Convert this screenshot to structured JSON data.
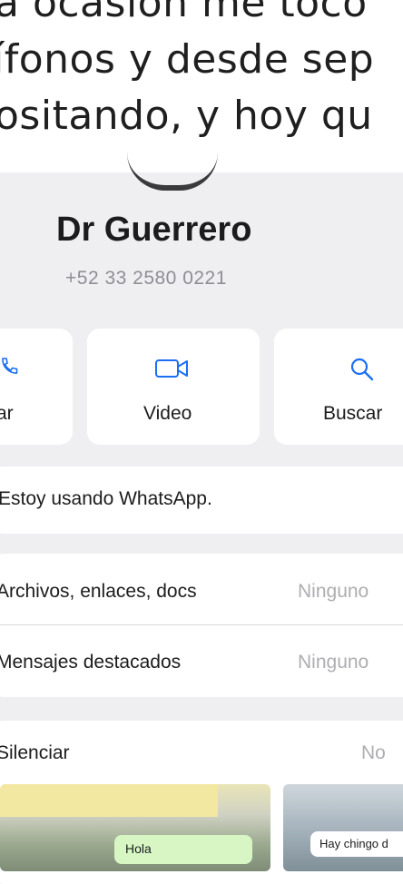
{
  "caption": {
    "line1": "a ocasión me tocó",
    "line2": "ífonos y desde sep",
    "line3": "ositando, y hoy qu"
  },
  "contact": {
    "name": "Dr Guerrero",
    "phone": "+52 33 2580 0221"
  },
  "actions": [
    {
      "label": "ar",
      "icon": "phone-icon"
    },
    {
      "label": "Video",
      "icon": "video-camera-icon"
    },
    {
      "label": "Buscar",
      "icon": "search-icon"
    }
  ],
  "status": "Estoy usando WhatsApp.",
  "rows": [
    {
      "label": "Archivos, enlaces, docs",
      "value": "Ninguno"
    },
    {
      "label": "Mensajes destacados",
      "value": "Ninguno"
    }
  ],
  "mute": {
    "label": "Silenciar",
    "value": "No"
  },
  "thumbnails": [
    {
      "bubble": "Hola"
    },
    {
      "bubble": "Hay chingo d"
    }
  ],
  "colors": {
    "accent": "#1c6ef2",
    "background": "#efeff2",
    "card": "#ffffff",
    "secondary_text": "#8e8e93"
  }
}
